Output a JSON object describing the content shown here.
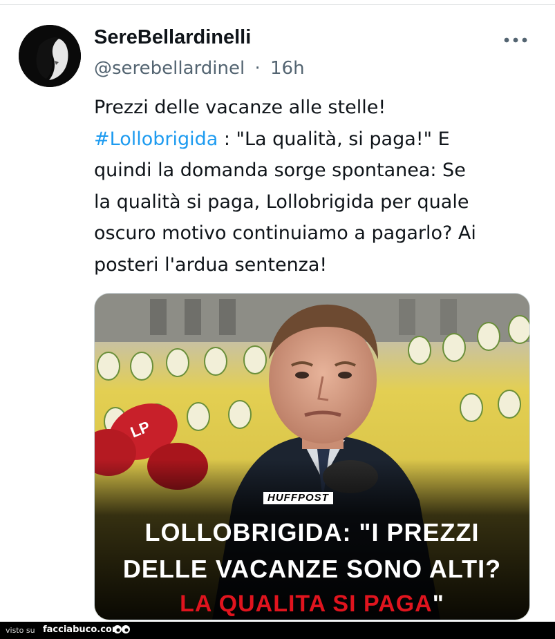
{
  "tweet": {
    "display_name": "SereBellardinelli",
    "handle": "@serebellardinel",
    "separator": "·",
    "time": "16h",
    "more_label": "•••",
    "text_line1": "Prezzi delle vacanze alle stelle!",
    "hashtag": "#Lollobrigida",
    "text_after_hashtag": " : \"La qualità, si paga!\" E",
    "text_rest": "quindi la domanda sorge spontanea: Se\nla qualità si paga, Lollobrigida per quale\noscuro motivo continuiamo a pagarlo? Ai\nposteri l'ardua sentenza!"
  },
  "media": {
    "brand": "HUFFPOST",
    "headline_line1": "LOLLOBRIGIDA: \"I PREZZI",
    "headline_line2": "DELLE VACANZE SONO ALTI?",
    "headline_line3_red": "LA QUALITA SI PAGA",
    "headline_line3_quote": "\"",
    "mic_text": "LP",
    "colors": {
      "headline_red": "#e0141e",
      "backdrop_yellow": "#e8d44a"
    }
  },
  "footer": {
    "visto_su": "visto su",
    "site": "facciabuco.com"
  },
  "colors": {
    "link": "#1d9bf0",
    "muted": "#536471",
    "text": "#0f1419"
  }
}
